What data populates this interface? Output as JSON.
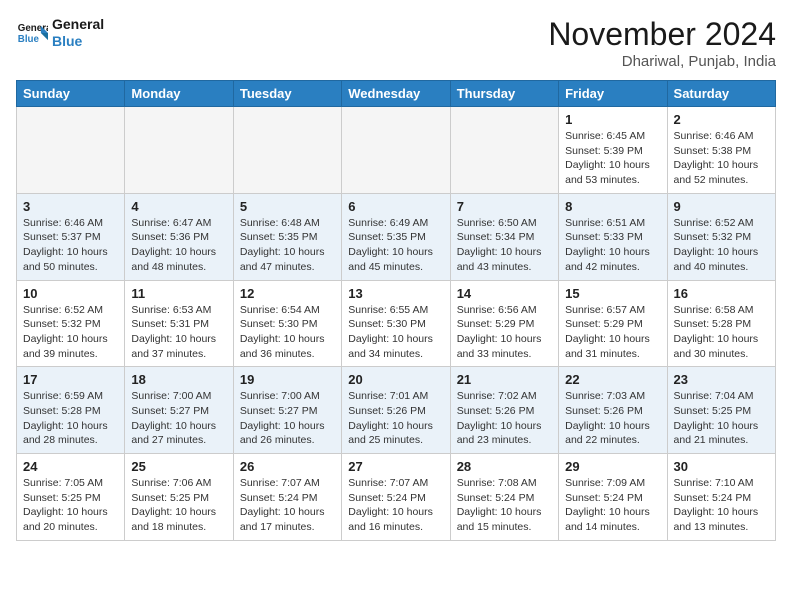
{
  "header": {
    "logo_line1": "General",
    "logo_line2": "Blue",
    "month": "November 2024",
    "location": "Dhariwal, Punjab, India"
  },
  "weekdays": [
    "Sunday",
    "Monday",
    "Tuesday",
    "Wednesday",
    "Thursday",
    "Friday",
    "Saturday"
  ],
  "weeks": [
    [
      {
        "day": "",
        "info": ""
      },
      {
        "day": "",
        "info": ""
      },
      {
        "day": "",
        "info": ""
      },
      {
        "day": "",
        "info": ""
      },
      {
        "day": "",
        "info": ""
      },
      {
        "day": "1",
        "info": "Sunrise: 6:45 AM\nSunset: 5:39 PM\nDaylight: 10 hours\nand 53 minutes."
      },
      {
        "day": "2",
        "info": "Sunrise: 6:46 AM\nSunset: 5:38 PM\nDaylight: 10 hours\nand 52 minutes."
      }
    ],
    [
      {
        "day": "3",
        "info": "Sunrise: 6:46 AM\nSunset: 5:37 PM\nDaylight: 10 hours\nand 50 minutes."
      },
      {
        "day": "4",
        "info": "Sunrise: 6:47 AM\nSunset: 5:36 PM\nDaylight: 10 hours\nand 48 minutes."
      },
      {
        "day": "5",
        "info": "Sunrise: 6:48 AM\nSunset: 5:35 PM\nDaylight: 10 hours\nand 47 minutes."
      },
      {
        "day": "6",
        "info": "Sunrise: 6:49 AM\nSunset: 5:35 PM\nDaylight: 10 hours\nand 45 minutes."
      },
      {
        "day": "7",
        "info": "Sunrise: 6:50 AM\nSunset: 5:34 PM\nDaylight: 10 hours\nand 43 minutes."
      },
      {
        "day": "8",
        "info": "Sunrise: 6:51 AM\nSunset: 5:33 PM\nDaylight: 10 hours\nand 42 minutes."
      },
      {
        "day": "9",
        "info": "Sunrise: 6:52 AM\nSunset: 5:32 PM\nDaylight: 10 hours\nand 40 minutes."
      }
    ],
    [
      {
        "day": "10",
        "info": "Sunrise: 6:52 AM\nSunset: 5:32 PM\nDaylight: 10 hours\nand 39 minutes."
      },
      {
        "day": "11",
        "info": "Sunrise: 6:53 AM\nSunset: 5:31 PM\nDaylight: 10 hours\nand 37 minutes."
      },
      {
        "day": "12",
        "info": "Sunrise: 6:54 AM\nSunset: 5:30 PM\nDaylight: 10 hours\nand 36 minutes."
      },
      {
        "day": "13",
        "info": "Sunrise: 6:55 AM\nSunset: 5:30 PM\nDaylight: 10 hours\nand 34 minutes."
      },
      {
        "day": "14",
        "info": "Sunrise: 6:56 AM\nSunset: 5:29 PM\nDaylight: 10 hours\nand 33 minutes."
      },
      {
        "day": "15",
        "info": "Sunrise: 6:57 AM\nSunset: 5:29 PM\nDaylight: 10 hours\nand 31 minutes."
      },
      {
        "day": "16",
        "info": "Sunrise: 6:58 AM\nSunset: 5:28 PM\nDaylight: 10 hours\nand 30 minutes."
      }
    ],
    [
      {
        "day": "17",
        "info": "Sunrise: 6:59 AM\nSunset: 5:28 PM\nDaylight: 10 hours\nand 28 minutes."
      },
      {
        "day": "18",
        "info": "Sunrise: 7:00 AM\nSunset: 5:27 PM\nDaylight: 10 hours\nand 27 minutes."
      },
      {
        "day": "19",
        "info": "Sunrise: 7:00 AM\nSunset: 5:27 PM\nDaylight: 10 hours\nand 26 minutes."
      },
      {
        "day": "20",
        "info": "Sunrise: 7:01 AM\nSunset: 5:26 PM\nDaylight: 10 hours\nand 25 minutes."
      },
      {
        "day": "21",
        "info": "Sunrise: 7:02 AM\nSunset: 5:26 PM\nDaylight: 10 hours\nand 23 minutes."
      },
      {
        "day": "22",
        "info": "Sunrise: 7:03 AM\nSunset: 5:26 PM\nDaylight: 10 hours\nand 22 minutes."
      },
      {
        "day": "23",
        "info": "Sunrise: 7:04 AM\nSunset: 5:25 PM\nDaylight: 10 hours\nand 21 minutes."
      }
    ],
    [
      {
        "day": "24",
        "info": "Sunrise: 7:05 AM\nSunset: 5:25 PM\nDaylight: 10 hours\nand 20 minutes."
      },
      {
        "day": "25",
        "info": "Sunrise: 7:06 AM\nSunset: 5:25 PM\nDaylight: 10 hours\nand 18 minutes."
      },
      {
        "day": "26",
        "info": "Sunrise: 7:07 AM\nSunset: 5:24 PM\nDaylight: 10 hours\nand 17 minutes."
      },
      {
        "day": "27",
        "info": "Sunrise: 7:07 AM\nSunset: 5:24 PM\nDaylight: 10 hours\nand 16 minutes."
      },
      {
        "day": "28",
        "info": "Sunrise: 7:08 AM\nSunset: 5:24 PM\nDaylight: 10 hours\nand 15 minutes."
      },
      {
        "day": "29",
        "info": "Sunrise: 7:09 AM\nSunset: 5:24 PM\nDaylight: 10 hours\nand 14 minutes."
      },
      {
        "day": "30",
        "info": "Sunrise: 7:10 AM\nSunset: 5:24 PM\nDaylight: 10 hours\nand 13 minutes."
      }
    ]
  ]
}
